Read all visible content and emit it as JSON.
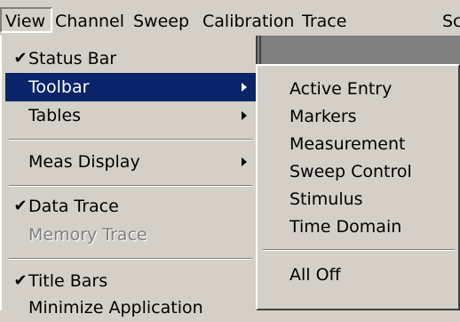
{
  "menubar": {
    "items": [
      "View",
      "Channel",
      "Sweep",
      "Calibration",
      "Trace",
      "Sc"
    ]
  },
  "view_menu": {
    "items": [
      {
        "label": "Status Bar",
        "checked": "✔"
      },
      {
        "label": "Toolbar"
      },
      {
        "label": "Tables"
      },
      {
        "label": "Meas Display"
      },
      {
        "label": "Data Trace",
        "checked": "✔"
      },
      {
        "label": "Memory Trace"
      },
      {
        "label": "Title Bars",
        "checked": "✔"
      },
      {
        "label": "Minimize Application"
      }
    ]
  },
  "toolbar_submenu": {
    "items": [
      "Active Entry",
      "Markers",
      "Measurement",
      "Sweep Control",
      "Stimulus",
      "Time Domain",
      "All Off"
    ]
  },
  "colors": {
    "menu_bg": "#d4d0c8",
    "highlight": "#0a246a",
    "disabled_text": "#808080"
  }
}
